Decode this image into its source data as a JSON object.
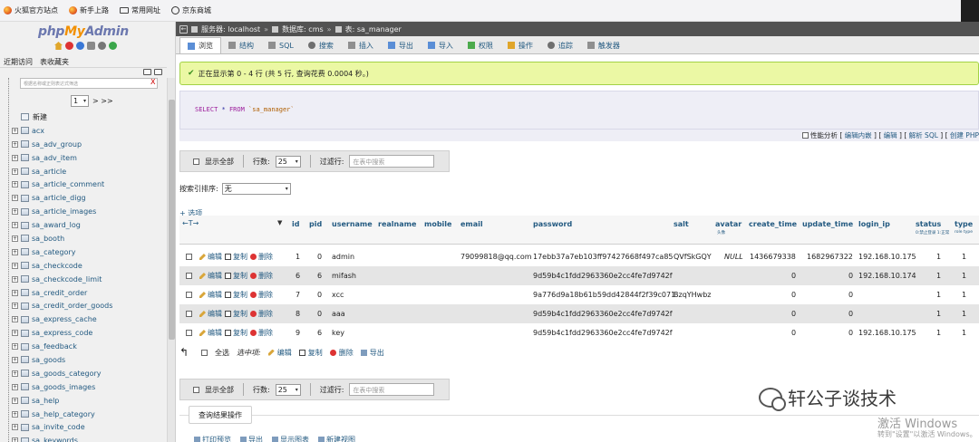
{
  "bookmarks": {
    "items": [
      "火狐官方站点",
      "新手上路",
      "常用网址",
      "京东商城"
    ]
  },
  "sidebar": {
    "logo": {
      "php": "php",
      "my": "My",
      "admin": "Admin"
    },
    "recent_tab": "近期访问",
    "favorites_tab": "表收藏夹",
    "filter_placeholder": "根据名称或正则表达式筛选",
    "filter_clear": "X",
    "page_value": "1",
    "page_next": "> >>",
    "new_label": "新建",
    "tables": [
      "acx",
      "sa_adv_group",
      "sa_adv_item",
      "sa_article",
      "sa_article_comment",
      "sa_article_digg",
      "sa_article_images",
      "sa_award_log",
      "sa_booth",
      "sa_category",
      "sa_checkcode",
      "sa_checkcode_limit",
      "sa_credit_order",
      "sa_credit_order_goods",
      "sa_express_cache",
      "sa_express_code",
      "sa_feedback",
      "sa_goods",
      "sa_goods_category",
      "sa_goods_images",
      "sa_help",
      "sa_help_category",
      "sa_invite_code",
      "sa_keywords"
    ]
  },
  "breadcrumb": {
    "server": "服务器: localhost",
    "database": "数据库: cms",
    "table": "表: sa_manager"
  },
  "tabs": [
    "浏览",
    "结构",
    "SQL",
    "搜索",
    "插入",
    "导出",
    "导入",
    "权限",
    "操作",
    "追踪",
    "触发器"
  ],
  "message": "正在显示第 0 - 4 行 (共 5 行, 查询花费 0.0004 秒。)",
  "sql": {
    "select": "SELECT",
    "star": "*",
    "from": "FROM",
    "table": "`sa_manager`"
  },
  "sql_links": {
    "profiling": "性能分析",
    "inline_edit": "编辑内嵌",
    "edit": "编辑",
    "explain": "解析 SQL",
    "create_php": "创建 PHP"
  },
  "nav": {
    "show_all": "显示全部",
    "rows_label": "行数:",
    "rows_value": "25",
    "filter_label": "过滤行:",
    "filter_placeholder": "在表中搜索"
  },
  "sort": {
    "label": "按索引排序:",
    "value": "无"
  },
  "options_link": "+ 选项",
  "grid": {
    "arrows": "←T→",
    "columns": [
      {
        "key": "id",
        "label": "id",
        "sub": ""
      },
      {
        "key": "pid",
        "label": "pid",
        "sub": ""
      },
      {
        "key": "username",
        "label": "username",
        "sub": ""
      },
      {
        "key": "realname",
        "label": "realname",
        "sub": ""
      },
      {
        "key": "mobile",
        "label": "mobile",
        "sub": ""
      },
      {
        "key": "email",
        "label": "email",
        "sub": ""
      },
      {
        "key": "password",
        "label": "password",
        "sub": ""
      },
      {
        "key": "salt",
        "label": "salt",
        "sub": ""
      },
      {
        "key": "avatar",
        "label": "avatar",
        "sub": "头像"
      },
      {
        "key": "create_time",
        "label": "create_time",
        "sub": ""
      },
      {
        "key": "update_time",
        "label": "update_time",
        "sub": ""
      },
      {
        "key": "login_ip",
        "label": "login_ip",
        "sub": ""
      },
      {
        "key": "status",
        "label": "status",
        "sub": "0:禁止登录 1:正常"
      },
      {
        "key": "type",
        "label": "type",
        "sub": "role type"
      }
    ],
    "actions": {
      "edit": "编辑",
      "copy": "复制",
      "delete": "删除"
    },
    "rows": [
      {
        "id": "1",
        "pid": "0",
        "username": "admin",
        "realname": "",
        "mobile": "",
        "email": "79099818@qq.com",
        "password": "17ebb37a7eb103ff97427668f497ca85",
        "salt": "QVfSkGQY",
        "avatar": "NULL",
        "create_time": "1436679338",
        "update_time": "1682967322",
        "login_ip": "192.168.10.175",
        "status": "1",
        "type": "1"
      },
      {
        "id": "6",
        "pid": "6",
        "username": "mifash",
        "realname": "",
        "mobile": "",
        "email": "",
        "password": "9d59b4c1fdd2963360e2cc4fe7d9742f",
        "salt": "",
        "avatar": "",
        "create_time": "0",
        "update_time": "0",
        "login_ip": "192.168.10.174",
        "status": "1",
        "type": "1"
      },
      {
        "id": "7",
        "pid": "0",
        "username": "xcc",
        "realname": "",
        "mobile": "",
        "email": "",
        "password": "9a776d9a18b61b59dd42844f2f39c071",
        "salt": "BzqYHwbz",
        "avatar": "",
        "create_time": "0",
        "update_time": "0",
        "login_ip": "",
        "status": "1",
        "type": "1"
      },
      {
        "id": "8",
        "pid": "0",
        "username": "aaa",
        "realname": "",
        "mobile": "",
        "email": "",
        "password": "9d59b4c1fdd2963360e2cc4fe7d9742f",
        "salt": "",
        "avatar": "",
        "create_time": "0",
        "update_time": "0",
        "login_ip": "",
        "status": "1",
        "type": "1"
      },
      {
        "id": "9",
        "pid": "6",
        "username": "key",
        "realname": "",
        "mobile": "",
        "email": "",
        "password": "9d59b4c1fdd2963360e2cc4fe7d9742f",
        "salt": "",
        "avatar": "",
        "create_time": "0",
        "update_time": "0",
        "login_ip": "192.168.10.175",
        "status": "1",
        "type": "1"
      }
    ]
  },
  "bulk": {
    "select_all": "全选",
    "selected_label": "选中项:",
    "edit": "编辑",
    "copy": "复制",
    "delete": "删除",
    "export": "导出"
  },
  "query_ops": {
    "title": "查询结果操作",
    "print": "打印预览",
    "export": "导出",
    "chart": "显示图表",
    "view": "新建视图"
  },
  "watermark": {
    "account": "轩公子谈技术",
    "windows_title": "激活 Windows",
    "windows_sub": "转到\"设置\"以激活 Windows。"
  }
}
